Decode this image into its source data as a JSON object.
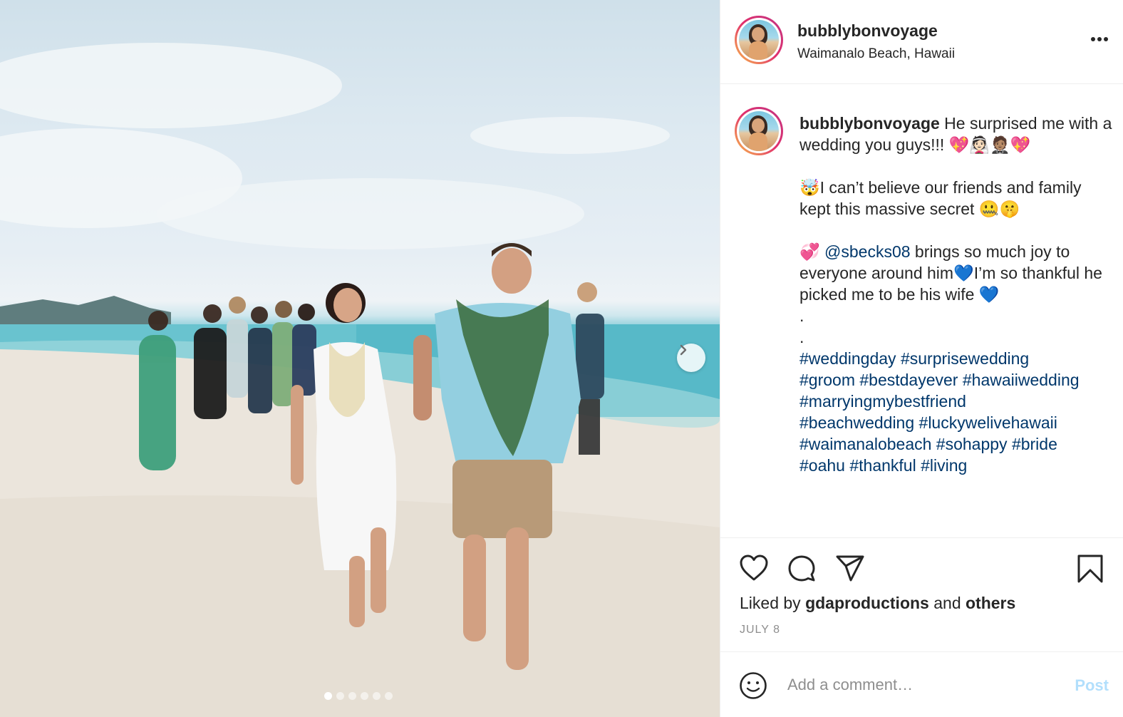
{
  "post": {
    "username": "bubblybonvoyage",
    "location": "Waimanalo Beach, Hawaii",
    "caption": {
      "username": "bubblybonvoyage",
      "line1": " He surprised me with a wedding you guys!!! 💖👰🏻🤵🏽💖",
      "line2": "🤯I can’t believe our friends and family kept this massive secret 🤐🤫",
      "line3_pre": "💞 ",
      "mention": "@sbecks08",
      "line3_post": " brings so much joy to everyone around him💙I’m so thankful he picked me to be his wife 💙",
      "dot1": ".",
      "dot2": ".",
      "hashtags": [
        "#weddingday",
        "#surprisewedding",
        "#groom",
        "#bestdayever",
        "#hawaiiwedding",
        "#marryingmybestfriend",
        "#beachwedding",
        "#luckywelivehawaii",
        "#waimanalobeach",
        "#sohappy",
        "#bride",
        "#oahu",
        "#thankful",
        "#living"
      ]
    },
    "likes": {
      "prefix": "Liked by ",
      "user": "gdaproductions",
      "middle": " and ",
      "others": "others"
    },
    "date": "JULY 8",
    "comment": {
      "placeholder": "Add a comment…",
      "post_label": "Post"
    },
    "carousel": {
      "total": 6,
      "active_index": 0
    }
  },
  "icons": {
    "like": "heart-icon",
    "comment": "comment-icon",
    "share": "share-icon",
    "save": "bookmark-icon",
    "more": "more-options-icon",
    "emoji": "smiley-icon",
    "next": "chevron-right-icon"
  },
  "colors": {
    "text": "#262626",
    "muted": "#8e8e8e",
    "link": "#00376b",
    "post_disabled": "#b2dffc",
    "border": "#efefef"
  }
}
